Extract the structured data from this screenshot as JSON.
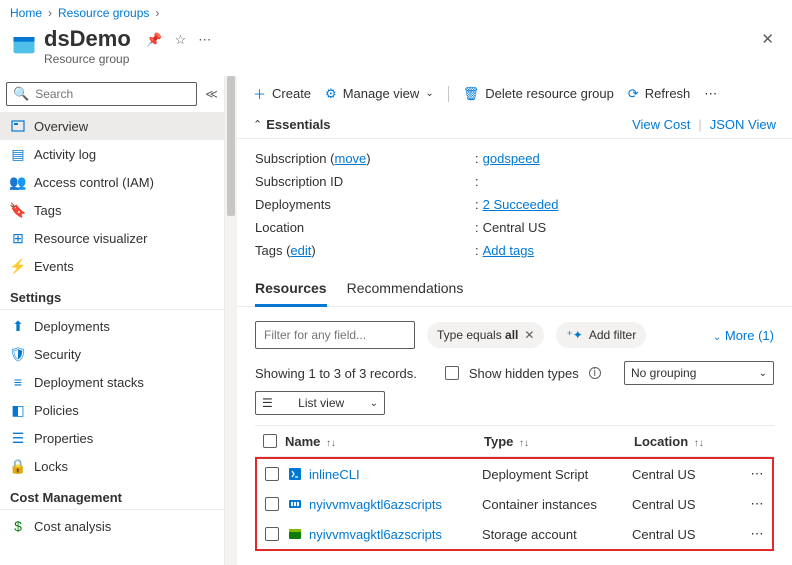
{
  "breadcrumb": {
    "home": "Home",
    "rg": "Resource groups"
  },
  "header": {
    "title": "dsDemo",
    "subtitle": "Resource group"
  },
  "search": {
    "placeholder": "Search"
  },
  "nav": {
    "overview": "Overview",
    "activity": "Activity log",
    "iam": "Access control (IAM)",
    "tags": "Tags",
    "rv": "Resource visualizer",
    "events": "Events",
    "g_settings": "Settings",
    "deployments": "Deployments",
    "security": "Security",
    "stacks": "Deployment stacks",
    "policies": "Policies",
    "properties": "Properties",
    "locks": "Locks",
    "g_cost": "Cost Management",
    "cost": "Cost analysis"
  },
  "cmd": {
    "create": "Create",
    "manage": "Manage view",
    "delete": "Delete resource group",
    "refresh": "Refresh"
  },
  "essentials": {
    "label": "Essentials",
    "viewcost": "View Cost",
    "json": "JSON View"
  },
  "props": {
    "sub_lbl": "Subscription",
    "sub_move": "move",
    "sub_val": "godspeed",
    "subid_lbl": "Subscription ID",
    "subid_val": "",
    "dep_lbl": "Deployments",
    "dep_val": "2 Succeeded",
    "loc_lbl": "Location",
    "loc_val": "Central US",
    "tags_lbl": "Tags",
    "tags_edit": "edit",
    "tags_val": "Add tags"
  },
  "tabs": {
    "res": "Resources",
    "rec": "Recommendations"
  },
  "filters": {
    "placeholder": "Filter for any field...",
    "type_pre": "Type equals ",
    "type_val": "all",
    "add": "Add filter",
    "more": "More (1)"
  },
  "meta": {
    "count": "Showing 1 to 3 of 3 records.",
    "hidden": "Show hidden types",
    "group": "No grouping",
    "view": "List view"
  },
  "table": {
    "h_name": "Name",
    "h_type": "Type",
    "h_loc": "Location",
    "rows": [
      {
        "name": "inlineCLI",
        "type": "Deployment Script",
        "loc": "Central US",
        "icon": "script",
        "iconColor": "#0078d4"
      },
      {
        "name": "nyivvmvagktl6azscripts",
        "type": "Container instances",
        "loc": "Central US",
        "icon": "container",
        "iconColor": "#0078d4"
      },
      {
        "name": "nyivvmvagktl6azscripts",
        "type": "Storage account",
        "loc": "Central US",
        "icon": "storage",
        "iconColor": "#107c10"
      }
    ]
  }
}
